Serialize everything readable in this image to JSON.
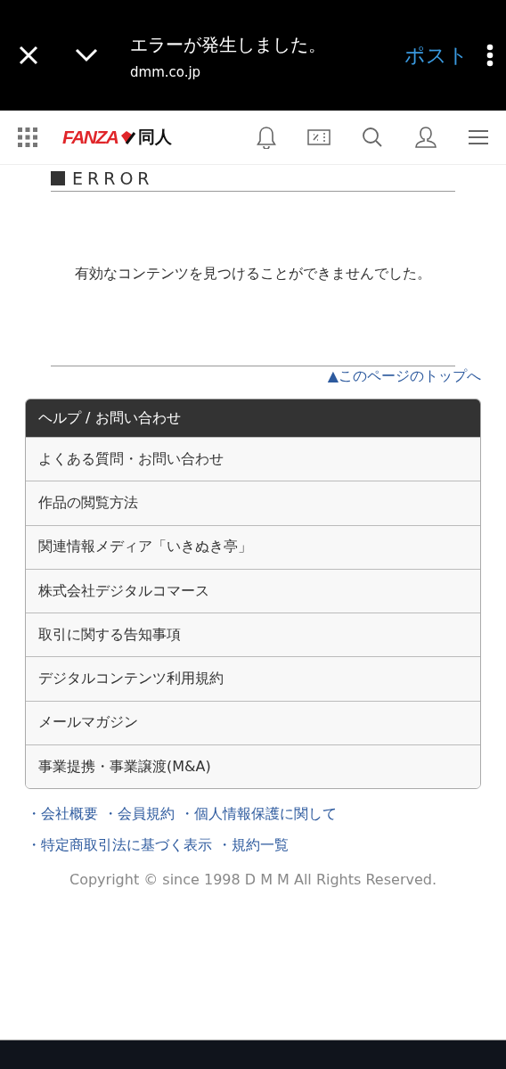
{
  "app_bar": {
    "title": "エラーが発生しました。",
    "url": "dmm.co.jp",
    "action": "ポスト"
  },
  "site_header": {
    "logo_brand": "FANZA",
    "logo_section": "同人"
  },
  "error": {
    "heading": "ERROR",
    "message": "有効なコンテンツを見つけることができませんでした。",
    "page_top_link": "▲このページのトップへ"
  },
  "help": {
    "title": "ヘルプ / お問い合わせ",
    "items": [
      "よくある質問・お問い合わせ",
      "作品の閲覧方法",
      "関連情報メディア「いきぬき亭」",
      "株式会社デジタルコマース",
      "取引に関する告知事項",
      "デジタルコンテンツ利用規約",
      "メールマガジン",
      "事業提携・事業譲渡(M&A)"
    ]
  },
  "footer_links": [
    [
      "・会社概要",
      "・会員規約",
      "・個人情報保護に関して"
    ],
    [
      "・特定商取引法に基づく表示",
      "・規約一覧"
    ]
  ],
  "copyright": "Copyright © since 1998 D M M All Rights Reserved."
}
